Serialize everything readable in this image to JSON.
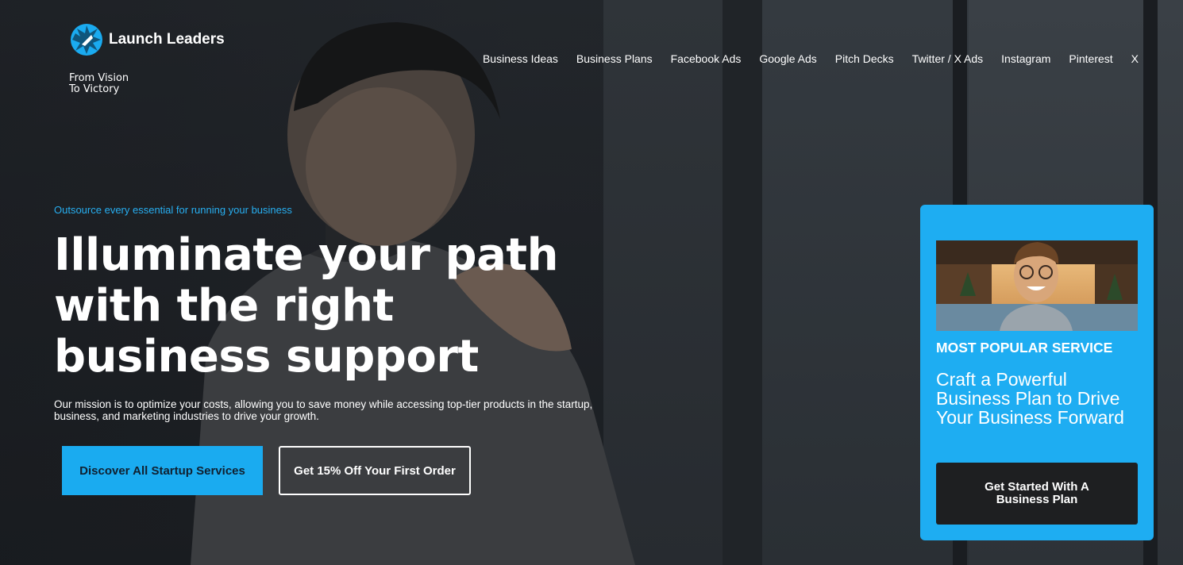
{
  "brand": {
    "name": "Launch Leaders",
    "tagline_line1": "From Vision",
    "tagline_line2": "To Victory",
    "accent_color": "#1aabf0"
  },
  "nav": {
    "items": [
      {
        "label": "Business Ideas"
      },
      {
        "label": "Business Plans"
      },
      {
        "label": "Facebook Ads"
      },
      {
        "label": "Google Ads"
      },
      {
        "label": "Pitch Decks"
      },
      {
        "label": "Twitter / X Ads"
      },
      {
        "label": "Instagram"
      },
      {
        "label": "Pinterest"
      },
      {
        "label": "X"
      }
    ]
  },
  "hero": {
    "eyebrow": "Outsource every essential for running your business",
    "headline": "Illuminate your path with the right business support",
    "mission": "Our mission is to optimize your costs, allowing you to save money while accessing top-tier products in the startup, business, and marketing industries to drive your growth.",
    "primary_cta": "Discover All Startup Services",
    "secondary_cta": "Get 15% Off Your First Order"
  },
  "promo_card": {
    "eyebrow": "MOST POPULAR SERVICE",
    "title": "Craft a Powerful Business Plan to Drive Your Business Forward",
    "cta": "Get Started With A Business Plan",
    "background_color": "#1eadf2"
  }
}
